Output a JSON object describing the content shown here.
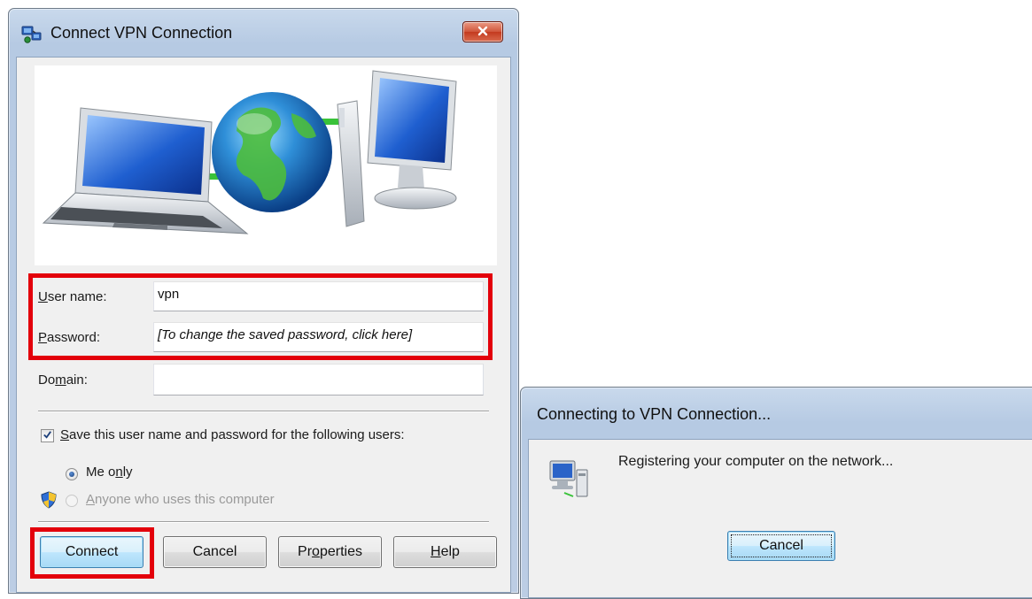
{
  "dialog_connect": {
    "title": "Connect VPN Connection",
    "close_glyph": "✕",
    "username": {
      "label_u": "U",
      "label_rest": "ser name:",
      "value": "vpn"
    },
    "password": {
      "label_u": "P",
      "label_rest": "assword:",
      "placeholder": "[To change the saved password, click here]"
    },
    "domain": {
      "label_pre": "Do",
      "label_u": "m",
      "label_rest": "ain:",
      "value": ""
    },
    "save_credentials": {
      "label_u": "S",
      "label_rest": "ave this user name and password for the following users:",
      "checked": true
    },
    "me_only": {
      "label_pre": "Me o",
      "label_u": "n",
      "label_rest": "ly",
      "checked": true
    },
    "anyone": {
      "label_u": "A",
      "label_rest": "nyone who uses this computer",
      "checked": false,
      "disabled": true
    },
    "buttons": {
      "connect": "Connect",
      "cancel": "Cancel",
      "properties_pre": "Pr",
      "properties_u": "o",
      "properties_rest": "perties",
      "help_u": "H",
      "help_rest": "elp"
    }
  },
  "dialog_progress": {
    "title": "Connecting to VPN Connection...",
    "status": "Registering your computer on the network...",
    "cancel": "Cancel"
  },
  "colors": {
    "highlight": "#e3000b",
    "title_bar": "#bccde4",
    "client_bg": "#f0f0f0"
  }
}
